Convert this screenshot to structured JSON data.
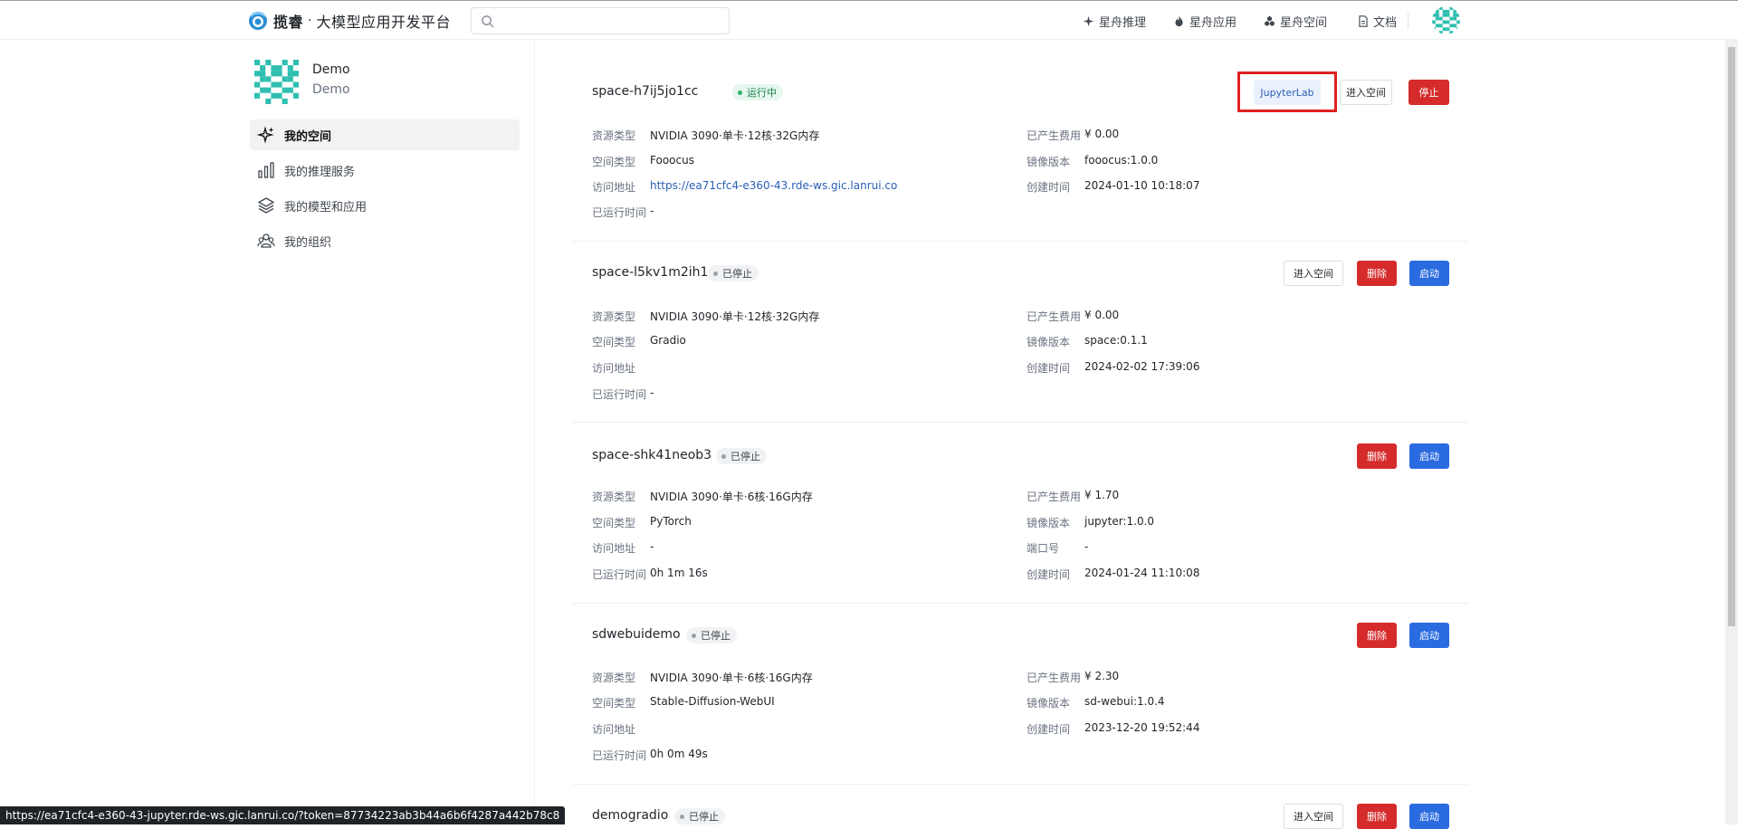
{
  "header": {
    "brand_name": "揽睿",
    "brand_dot": "·",
    "brand_sub": "大模型应用开发平台",
    "search_placeholder": "",
    "nav": [
      {
        "label": "星舟推理",
        "icon": "sparkle-icon"
      },
      {
        "label": "星舟应用",
        "icon": "flame-icon"
      },
      {
        "label": "星舟空间",
        "icon": "cluster-icon"
      },
      {
        "label": "文档",
        "icon": "document-icon"
      }
    ]
  },
  "profile": {
    "name": "Demo",
    "id": "Demo"
  },
  "sidebar": {
    "items": [
      {
        "label": "我的空间",
        "icon": "sparkle-icon",
        "active": true
      },
      {
        "label": "我的推理服务",
        "icon": "bar-chart-icon",
        "active": false
      },
      {
        "label": "我的模型和应用",
        "icon": "layers-icon",
        "active": false
      },
      {
        "label": "我的组织",
        "icon": "users-icon",
        "active": false
      }
    ]
  },
  "labels": {
    "resource": "资源类型",
    "space_type": "空间类型",
    "url": "访问地址",
    "runtime": "已运行时间",
    "cost": "已产生费用",
    "image": "镜像版本",
    "created": "创建时间",
    "port": "端口号"
  },
  "buttons": {
    "jupyter": "JupyterLab",
    "enter": "进入空间",
    "stop": "停止",
    "delete": "删除",
    "start": "启动"
  },
  "spaces": [
    {
      "name": "space-h7ij5jo1cc",
      "status": "运行中",
      "resource": "NVIDIA 3090·单卡·12核·32G内存",
      "space_type": "Fooocus",
      "url": "https://ea71cfc4-e360-43.rde-ws.gic.lanrui.co",
      "runtime": "-",
      "cost": "¥ 0.00",
      "image": "fooocus:1.0.0",
      "created": "2024-01-10 10:18:07"
    },
    {
      "name": "space-l5kv1m2ih1",
      "status": "已停止",
      "resource": "NVIDIA 3090·单卡·12核·32G内存",
      "space_type": "Gradio",
      "url": "",
      "runtime": "-",
      "cost": "¥ 0.00",
      "image": "space:0.1.1",
      "created": "2024-02-02 17:39:06"
    },
    {
      "name": "space-shk41neob3",
      "status": "已停止",
      "resource": "NVIDIA 3090·单卡·6核·16G内存",
      "space_type": "PyTorch",
      "url": "-",
      "runtime": "0h 1m 16s",
      "cost": "¥ 1.70",
      "image": "jupyter:1.0.0",
      "port": "-",
      "created": "2024-01-24 11:10:08"
    },
    {
      "name": "sdwebuidemo",
      "status": "已停止",
      "resource": "NVIDIA 3090·单卡·6核·16G内存",
      "space_type": "Stable-Diffusion-WebUI",
      "url": "",
      "runtime": "0h 0m 49s",
      "cost": "¥ 2.30",
      "image": "sd-webui:1.0.4",
      "created": "2023-12-20 19:52:44"
    },
    {
      "name": "demogradio",
      "status": "已停止"
    }
  ],
  "status_url": "https://ea71cfc4-e360-43-jupyter.rde-ws.gic.lanrui.co/?token=87734223ab3b44a6b6f4287a442b78c8",
  "colors": {
    "accent_blue": "#2b6be0",
    "danger_red": "#d52b2b",
    "running_green": "#2fb36b",
    "highlight_red": "#e02020"
  }
}
